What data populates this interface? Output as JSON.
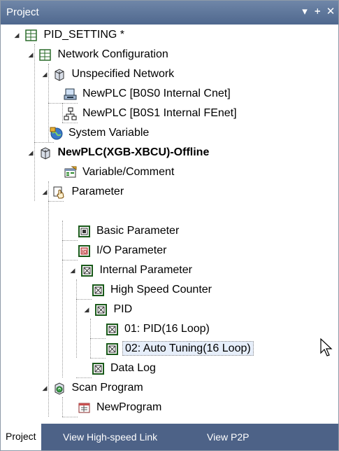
{
  "window": {
    "title": "Project",
    "buttons": {
      "dropdown": "▾",
      "pin": "ᚐ",
      "close": "✕"
    }
  },
  "tree": {
    "project_root": "PID_SETTING *",
    "network_configuration": "Network Configuration",
    "unspecified_network": "Unspecified Network",
    "newplc_cnet": "NewPLC [B0S0 Internal Cnet]",
    "newplc_fenet": "NewPLC [B0S1 Internal FEnet]",
    "system_variable": "System Variable",
    "plc": "NewPLC(XGB-XBCU)-Offline",
    "variable_comment": "Variable/Comment",
    "parameter": "Parameter",
    "basic_parameter": "Basic Parameter",
    "io_parameter": "I/O Parameter",
    "internal_parameter": "Internal Parameter",
    "high_speed_counter": "High Speed Counter",
    "pid": "PID",
    "pid_01": "01: PID(16 Loop)",
    "pid_02": "02: Auto Tuning(16 Loop)",
    "data_log": "Data Log",
    "scan_program": "Scan Program",
    "new_program": "NewProgram"
  },
  "tabs": [
    "Project",
    "View High-speed Link",
    "View P2P"
  ],
  "active_tab": "Project"
}
